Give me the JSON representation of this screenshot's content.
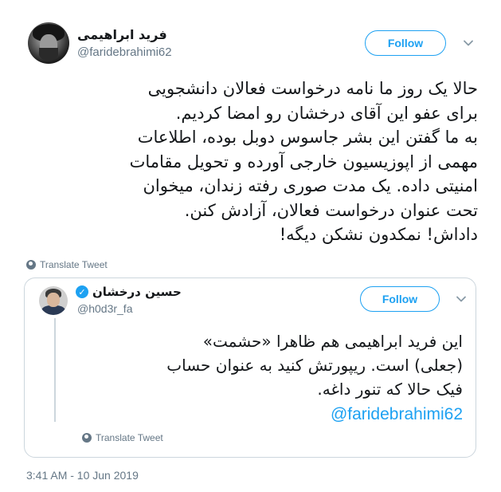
{
  "tweet": {
    "author": {
      "name": "فرید ابراهیمی",
      "handle": "@faridebrahimi62",
      "avatar_icon": "avatar-photo"
    },
    "follow_label": "Follow",
    "body_lines": [
      "حالا یک روز ما نامه درخواست فعالان دانشجویی",
      "برای عفو این آقای درخشان رو امضا کردیم.",
      "به ما گفتن این بشر جاسوس دوبل بوده، اطلاعات",
      "مهمی از اپوزیسیون خارجی آورده و تحویل مقامات",
      "امنیتی داده. یک مدت صوری رفته زندان، میخوان",
      "تحت عنوان درخواست فعالان، آزادش کنن.",
      "داداش! نمکدون نشکن دیگه!"
    ],
    "translate_label": "Translate Tweet",
    "timestamp": "3:41 AM - 10 Jun 2019"
  },
  "quoted": {
    "author": {
      "name": "حسین درخشان",
      "handle": "@h0d3r_fa",
      "verified": true
    },
    "follow_label": "Follow",
    "body_lines": [
      "این فرید ابراهیمی هم ظاهرا «حشمت»",
      "(جعلی) است. ریپورتش کنید به عنوان حساب",
      "فیک حالا که تنور داغه."
    ],
    "mention": "@faridebrahimi62",
    "translate_label": "Translate Tweet"
  },
  "colors": {
    "accent": "#1da1f2",
    "text": "#14171a",
    "muted": "#657786",
    "border": "#ccd6dd"
  }
}
